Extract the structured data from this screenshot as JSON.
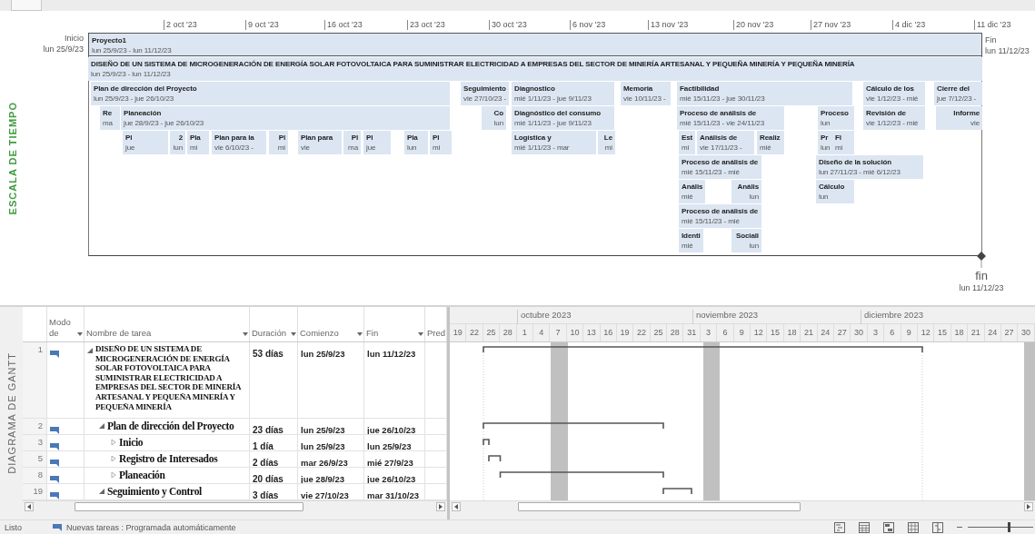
{
  "timeline": {
    "label": "ESCALA DE TIEMPO",
    "start": {
      "label": "Inicio",
      "date": "lun 25/9/23"
    },
    "finish": {
      "label": "Fin",
      "date": "lun 11/12/23"
    },
    "ticks": [
      "2 oct '23",
      "9 oct '23",
      "16 oct '23",
      "23 oct '23",
      "30 oct '23",
      "6 nov '23",
      "13 nov '23",
      "20 nov '23",
      "27 nov '23",
      "4 dic '23",
      "11 dic '23"
    ],
    "bars": [
      {
        "kind": "project",
        "title": "Proyecto1",
        "dates": "lun 25/9/23 - lun 11/12/23"
      },
      {
        "kind": "task",
        "title": "DISEÑO DE UN SISTEMA DE MICROGENERACIÓN DE ENERGÍA SOLAR FOTOVOLTAICA PARA SUMINISTRAR ELECTRICIDAD A EMPRESAS DEL SECTOR DE MINERÍA ARTESANAL Y PEQUEÑA MINERÍA Y PEQUEÑA MINERÍA",
        "dates": "lun 25/9/23 - lun 11/12/23"
      },
      {
        "kind": "task",
        "title": "Plan de dirección del Proyecto",
        "dates": "lun 25/9/23 - jue 26/10/23"
      },
      {
        "kind": "task",
        "title": "Seguimiento",
        "dates": "vie 27/10/23 -"
      },
      {
        "kind": "task",
        "title": "Diagnostico",
        "dates": "mié 1/11/23 - jue 9/11/23"
      },
      {
        "kind": "task",
        "title": "Memoria",
        "dates": "vie 10/11/23 -"
      },
      {
        "kind": "task",
        "title": "Factibilidad",
        "dates": "mié 15/11/23 - jue 30/11/23"
      },
      {
        "kind": "task",
        "title": "Cálculo de los",
        "dates": "vie 1/12/23 - mié"
      },
      {
        "kind": "task",
        "title": "Cierre del",
        "dates": "jue 7/12/23 -"
      },
      {
        "kind": "task",
        "title": "Re",
        "dates": "ma"
      },
      {
        "kind": "task",
        "title": "Planeación",
        "dates": "jue 28/9/23 - jue 26/10/23"
      },
      {
        "kind": "task",
        "title": "Co",
        "dates": "lun"
      },
      {
        "kind": "task",
        "title": "Diagnóstico del consumo",
        "dates": "mié 1/11/23 - jue 9/11/23"
      },
      {
        "kind": "task",
        "title": "Proceso de análisis de",
        "dates": "mié 15/11/23 - vie 24/11/23"
      },
      {
        "kind": "task",
        "title": "Proceso",
        "dates": "lun"
      },
      {
        "kind": "task",
        "title": "Revisión de",
        "dates": "vie 1/12/23 - mié"
      },
      {
        "kind": "task",
        "title": "Informe",
        "dates": "vie"
      },
      {
        "kind": "task",
        "title": "Pl",
        "dates": "jue"
      },
      {
        "kind": "task",
        "title": "2",
        "dates": "lun"
      },
      {
        "kind": "task",
        "title": "Pla",
        "dates": "mi"
      },
      {
        "kind": "task",
        "title": "Plan para la",
        "dates": "vie 6/10/23 -"
      },
      {
        "kind": "task",
        "title": "Pl",
        "dates": "mi"
      },
      {
        "kind": "task",
        "title": "Plan para",
        "dates": "vie"
      },
      {
        "kind": "task",
        "title": "Pl",
        "dates": "ma"
      },
      {
        "kind": "task",
        "title": "Pl",
        "dates": "jue"
      },
      {
        "kind": "task",
        "title": "Pla",
        "dates": "lun"
      },
      {
        "kind": "task",
        "title": "Pl",
        "dates": "mi"
      },
      {
        "kind": "task",
        "title": "Logística y",
        "dates": "mié 1/11/23 - mar"
      },
      {
        "kind": "task",
        "title": "Le",
        "dates": "mi"
      },
      {
        "kind": "task",
        "title": "Est",
        "dates": "mi"
      },
      {
        "kind": "task",
        "title": "Análisis de",
        "dates": "vie 17/11/23 -"
      },
      {
        "kind": "task",
        "title": "Realiz",
        "dates": "mié"
      },
      {
        "kind": "task",
        "title": "Pr",
        "dates": "lun"
      },
      {
        "kind": "task",
        "title": "Fl",
        "dates": "mi"
      },
      {
        "kind": "task",
        "title": "Proceso de análisis de",
        "dates": "mié 15/11/23 - mié"
      },
      {
        "kind": "task",
        "title": "Diseño de la solución",
        "dates": "lun 27/11/23 - mié 6/12/23"
      },
      {
        "kind": "task",
        "title": "Anális",
        "dates": "mié"
      },
      {
        "kind": "task",
        "title": "Anális",
        "dates": "lun"
      },
      {
        "kind": "task",
        "title": "Cálculo",
        "dates": "lun"
      },
      {
        "kind": "task",
        "title": "Proceso de análisis de",
        "dates": "mié 15/11/23 - mié"
      },
      {
        "kind": "task",
        "title": "Identi",
        "dates": "mié"
      },
      {
        "kind": "task",
        "title": "Sociali",
        "dates": "lun"
      }
    ],
    "milestone": {
      "label": "fin",
      "date": "lun 11/12/23"
    }
  },
  "gantt": {
    "label": "DIAGRAMA DE GANTT",
    "columns": [
      {
        "label": "Modo de",
        "menu": true
      },
      {
        "label": "Nombre de tarea",
        "menu": true
      },
      {
        "label": "Duración",
        "menu": true
      },
      {
        "label": "Comienzo",
        "menu": true
      },
      {
        "label": "Fin",
        "menu": true
      },
      {
        "label": "Pred",
        "menu": false
      }
    ],
    "tasks": [
      {
        "id": "1",
        "name": "DISEÑO DE UN SISTEMA DE MICROGENERACIÓN DE ENERGÍA SOLAR FOTOVOLTAICA PARA SUMINISTRAR ELECTRICIDAD A EMPRESAS DEL SECTOR DE MINERÍA ARTESANAL Y PEQUEÑA MINERÍA Y PEQUEÑA MINERÍA",
        "duration": "53 días",
        "start": "lun 25/9/23",
        "finish": "lun 11/12/23",
        "expanded": true,
        "children": [
          {
            "id": "2",
            "name": "Plan de dirección del Proyecto",
            "duration": "23 días",
            "start": "lun 25/9/23",
            "finish": "jue 26/10/23",
            "expanded": true,
            "children": [
              {
                "id": "3",
                "name": "Inicio",
                "duration": "1 día",
                "start": "lun 25/9/23",
                "finish": "lun 25/9/23",
                "expanded": false
              },
              {
                "id": "5",
                "name": "Registro de Interesados",
                "duration": "2 días",
                "start": "mar 26/9/23",
                "finish": "mié 27/9/23",
                "expanded": false
              },
              {
                "id": "8",
                "name": "Planeación",
                "duration": "20 días",
                "start": "jue 28/9/23",
                "finish": "jue 26/10/23",
                "expanded": false
              }
            ]
          },
          {
            "id": "19",
            "name": "Seguimiento y Control",
            "duration": "3 días",
            "start": "vie 27/10/23",
            "finish": "mar 31/10/23",
            "expanded": true
          }
        ]
      }
    ],
    "months": [
      "octubre 2023",
      "noviembre 2023",
      "diciembre 2023"
    ],
    "days": [
      "19",
      "22",
      "25",
      "28",
      "1",
      "4",
      "7",
      "10",
      "13",
      "16",
      "19",
      "22",
      "25",
      "28",
      "31",
      "3",
      "6",
      "9",
      "12",
      "15",
      "18",
      "21",
      "24",
      "27",
      "30",
      "3",
      "6",
      "9",
      "12",
      "15",
      "18",
      "21",
      "24",
      "27",
      "30"
    ]
  },
  "status_bar": {
    "state": "Listo",
    "new_tasks": "Nuevas tareas : Programada automáticamente",
    "zoom": {
      "level": 0.62
    }
  }
}
